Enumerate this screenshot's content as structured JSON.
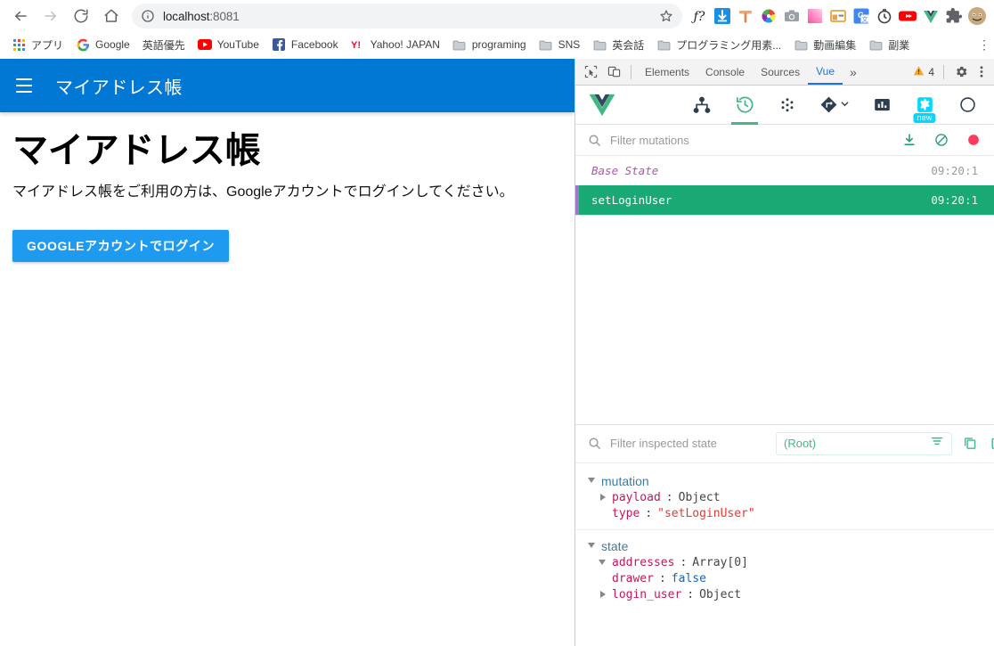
{
  "browser": {
    "nav": {
      "back": "back-arrow",
      "forward": "forward-arrow",
      "reload": "reload",
      "home": "home"
    },
    "omnibox": {
      "info_icon": "site-information-icon",
      "url_host": "localhost",
      "url_port": ":8081",
      "url_full": "localhost:8081",
      "star_icon": "bookmark-star-icon"
    },
    "extensions": [
      {
        "name": "f-question-extension",
        "glyph": "ƒ?"
      },
      {
        "name": "download-extension",
        "glyph": "⬇"
      },
      {
        "name": "hammer-extension",
        "glyph": ""
      },
      {
        "name": "color-wheel-extension",
        "glyph": ""
      },
      {
        "name": "screenshot-camera-extension",
        "glyph": ""
      },
      {
        "name": "gradient-extension",
        "glyph": ""
      },
      {
        "name": "window-layout-extension",
        "glyph": ""
      },
      {
        "name": "google-translate-extension",
        "glyph": ""
      },
      {
        "name": "stopwatch-extension",
        "glyph": ""
      },
      {
        "name": "youtube-extension",
        "glyph": ""
      },
      {
        "name": "vue-devtools-extension",
        "glyph": ""
      },
      {
        "name": "puzzle-extensions-menu",
        "glyph": ""
      },
      {
        "name": "profile-avatar",
        "glyph": ""
      }
    ],
    "bookmarks": [
      {
        "label": "アプリ",
        "icon": "apps-grid-icon"
      },
      {
        "label": "Google",
        "icon": "google-g-icon"
      },
      {
        "label": "英語優先",
        "icon": "none"
      },
      {
        "label": "YouTube",
        "icon": "youtube-icon"
      },
      {
        "label": "Facebook",
        "icon": "facebook-icon"
      },
      {
        "label": "Yahoo! JAPAN",
        "icon": "yahoo-japan-icon"
      },
      {
        "label": "programing",
        "icon": "folder-icon"
      },
      {
        "label": "SNS",
        "icon": "folder-icon"
      },
      {
        "label": "英会話",
        "icon": "folder-icon"
      },
      {
        "label": "プログラミング用素...",
        "icon": "folder-icon"
      },
      {
        "label": "動画編集",
        "icon": "folder-icon"
      },
      {
        "label": "副業",
        "icon": "folder-icon"
      }
    ],
    "bookmark_overflow": "⋮"
  },
  "app": {
    "header": {
      "menu_icon": "hamburger-menu-icon",
      "title": "マイアドレス帳"
    },
    "page_title": "マイアドレス帳",
    "subtitle": "マイアドレス帳をご利用の方は、Googleアカウントでログインしてください。",
    "login_button": "GOOGLEアカウントでログイン",
    "colors": {
      "header_bg": "#0078d4",
      "button_bg": "#1e9bf0"
    }
  },
  "devtools": {
    "topbar": {
      "inspect_icon": "inspect-element-icon",
      "device_icon": "toggle-device-toolbar-icon",
      "tabs": [
        {
          "label": "Elements",
          "active": false
        },
        {
          "label": "Console",
          "active": false
        },
        {
          "label": "Sources",
          "active": false
        },
        {
          "label": "Vue",
          "active": true
        }
      ],
      "more_tabs": "»",
      "warning_count": "4",
      "warning_icon": "warning-triangle-icon",
      "settings_icon": "gear-icon",
      "kebab_icon": "more-options-icon"
    },
    "vue_toolbar": {
      "logo": "vue-logo-icon",
      "buttons": [
        {
          "name": "components-tab",
          "icon": "component-tree-icon",
          "active": false,
          "badge": null
        },
        {
          "name": "timeline-tab",
          "icon": "history-clock-icon",
          "active": true,
          "badge": null
        },
        {
          "name": "vuex-tab",
          "icon": "vuex-dots-icon",
          "active": false,
          "badge": null
        },
        {
          "name": "routing-tab",
          "icon": "route-diamond-icon",
          "active": false,
          "badge": null,
          "chevron": "⌄"
        },
        {
          "name": "performance-tab",
          "icon": "bar-chart-icon",
          "active": false,
          "badge": null
        },
        {
          "name": "settings-tab",
          "icon": "gear-icon",
          "active": false,
          "badge": "new"
        },
        {
          "name": "refresh-tab",
          "icon": "refresh-circle-icon",
          "active": false,
          "badge": null
        }
      ]
    },
    "mutations": {
      "filter_placeholder": "Filter mutations",
      "filter_value": "",
      "search_icon": "search-icon",
      "actions": [
        {
          "name": "export-mutations-button",
          "icon": "download-icon"
        },
        {
          "name": "clear-mutations-button",
          "icon": "no-entry-icon"
        },
        {
          "name": "record-mutations-button",
          "icon": "record-circle-icon"
        }
      ],
      "rows": [
        {
          "label": "Base State",
          "time": "09:20:1",
          "active": false,
          "base": true
        },
        {
          "label": "setLoginUser",
          "time": "09:20:1",
          "active": true,
          "base": false
        }
      ]
    },
    "inspected_state": {
      "filter_placeholder": "Filter inspected state",
      "filter_value": "",
      "search_icon": "search-icon",
      "root_select_value": "(Root)",
      "root_select_icon": "filter-lines-icon",
      "actions": [
        {
          "name": "copy-state-button",
          "icon": "copy-icon"
        },
        {
          "name": "paste-state-button",
          "icon": "paste-icon"
        }
      ],
      "tree": [
        {
          "key": "mutation",
          "expanded": true,
          "children": [
            {
              "arrow": "right",
              "key": "payload",
              "sep": ":",
              "value": "Object",
              "value_type": "object"
            },
            {
              "arrow": "none",
              "key": "type",
              "sep": ":",
              "value": "\"setLoginUser\"",
              "value_type": "string"
            }
          ]
        },
        {
          "key": "state",
          "expanded": true,
          "children": [
            {
              "arrow": "down",
              "key": "addresses",
              "sep": ":",
              "value": "Array[0]",
              "value_type": "object"
            },
            {
              "arrow": "none",
              "key": "drawer",
              "sep": ":",
              "value": "false",
              "value_type": "boolean"
            },
            {
              "arrow": "right",
              "key": "login_user",
              "sep": ":",
              "value": "Object",
              "value_type": "object"
            }
          ]
        }
      ]
    },
    "colors": {
      "accent_green": "#42b883",
      "active_row": "#19a974",
      "mutation_purple": "#9b7bc8",
      "tab_blue": "#1a73e8"
    }
  }
}
